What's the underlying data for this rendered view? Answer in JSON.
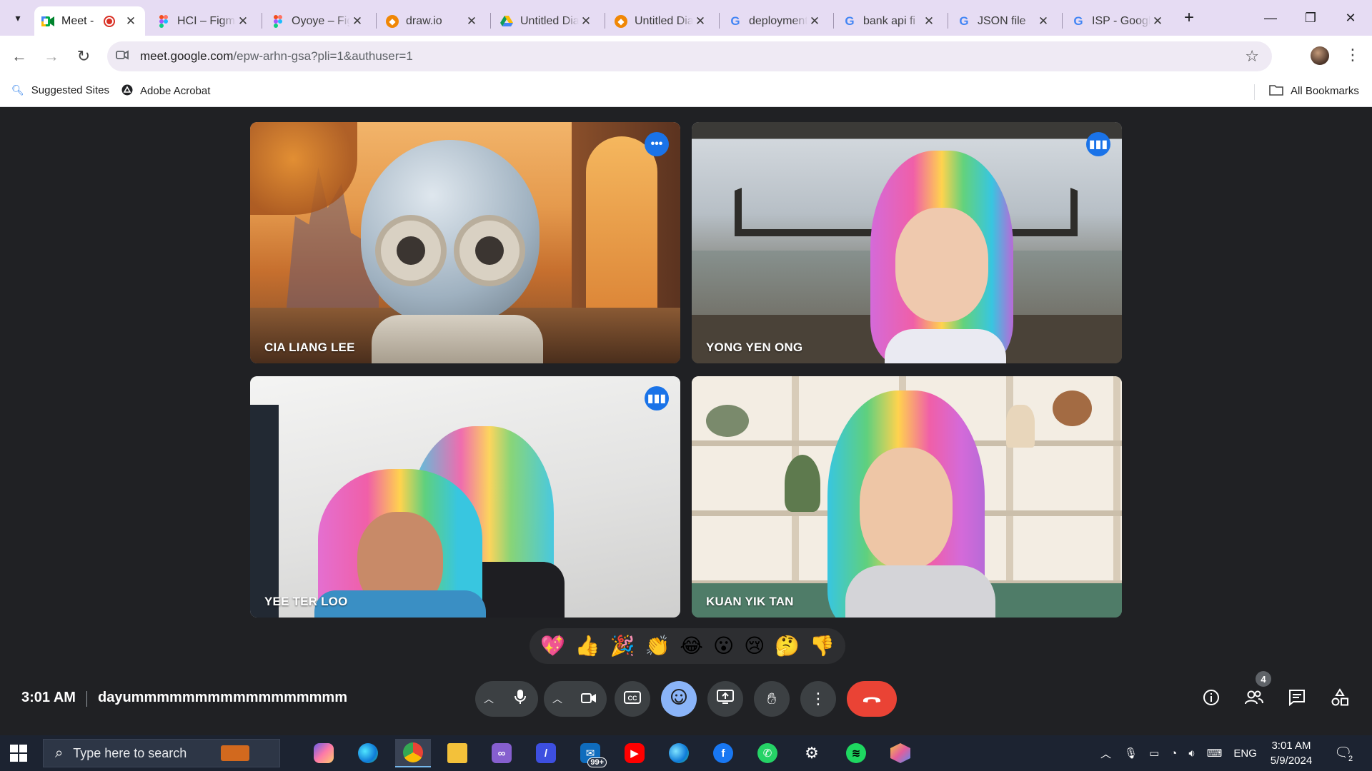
{
  "browser": {
    "tabs": [
      {
        "title": "Meet -",
        "favicon": "meet-icon",
        "recording": true
      },
      {
        "title": "HCI – Figma",
        "favicon": "figma-icon"
      },
      {
        "title": "Oyoye – Figma",
        "favicon": "figma-icon"
      },
      {
        "title": "draw.io",
        "favicon": "drawio-icon"
      },
      {
        "title": "Untitled Diagram",
        "favicon": "google-drive-icon"
      },
      {
        "title": "Untitled Diagram",
        "favicon": "drawio-icon"
      },
      {
        "title": "deployment",
        "favicon": "google-icon"
      },
      {
        "title": "bank api fi",
        "favicon": "google-icon"
      },
      {
        "title": "JSON file",
        "favicon": "google-icon"
      },
      {
        "title": "ISP - Google",
        "favicon": "google-icon"
      }
    ],
    "close_glyph": "✕",
    "new_tab_glyph": "+",
    "url_host": "meet.google.com",
    "url_path": "/epw-arhn-gsa?pli=1&authuser=1",
    "bookmarks": [
      {
        "label": "Suggested Sites",
        "icon": "search-icon"
      },
      {
        "label": "Adobe Acrobat",
        "icon": "acrobat-icon"
      }
    ],
    "all_bookmarks_label": "All Bookmarks"
  },
  "meet": {
    "participants": [
      {
        "name": "CIA LIANG LEE",
        "badge": "more-options-icon",
        "speaking": true
      },
      {
        "name": "YONG YEN ONG",
        "badge": "audio-level-icon",
        "speaking": false
      },
      {
        "name": "YEE TER LOO",
        "badge": "audio-level-icon",
        "speaking": false
      },
      {
        "name": "KUAN YIK TAN",
        "badge": "",
        "speaking": false
      }
    ],
    "reactions": [
      "💖",
      "👍",
      "🎉",
      "👏",
      "😂",
      "😮",
      "😢",
      "🤔",
      "👎"
    ],
    "time": "3:01 AM",
    "meeting_title": "dayummmmmmmmmmmmmmmmm",
    "people_count": "4",
    "colors": {
      "accent": "#8ab4f8",
      "end_call": "#ea4335",
      "stage": "#202124"
    }
  },
  "taskbar": {
    "search_placeholder": "Type here to search",
    "mail_badge": "99+",
    "language": "ENG",
    "time": "3:01 AM",
    "date": "5/9/2024",
    "notification_count": "2"
  }
}
